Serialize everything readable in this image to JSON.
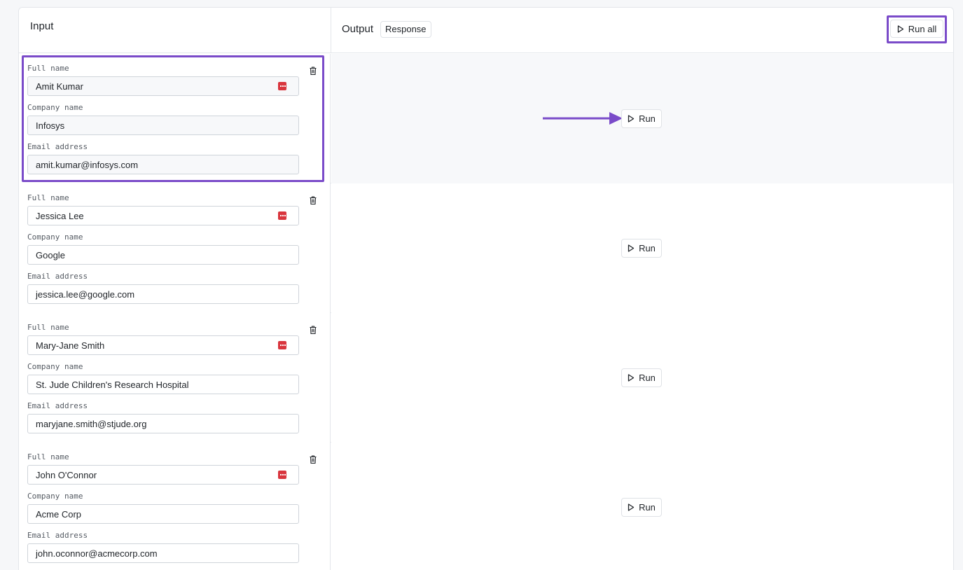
{
  "header": {
    "input_title": "Input",
    "output_title": "Output",
    "response_tag": "Response",
    "run_all_label": "Run all"
  },
  "fields": {
    "full_name_label": "Full name",
    "company_label": "Company name",
    "email_label": "Email address"
  },
  "run_label": "Run",
  "rows": [
    {
      "full_name": "Amit Kumar",
      "company": "Infosys",
      "email": "amit.kumar@infosys.com"
    },
    {
      "full_name": "Jessica Lee",
      "company": "Google",
      "email": "jessica.lee@google.com"
    },
    {
      "full_name": "Mary-Jane Smith",
      "company": "St. Jude Children's Research Hospital",
      "email": "maryjane.smith@stjude.org"
    },
    {
      "full_name": "John O'Connor",
      "company": "Acme Corp",
      "email": "john.oconnor@acmecorp.com"
    }
  ],
  "colors": {
    "highlight": "#7a4bc9",
    "dots_icon": "#d9363e"
  }
}
